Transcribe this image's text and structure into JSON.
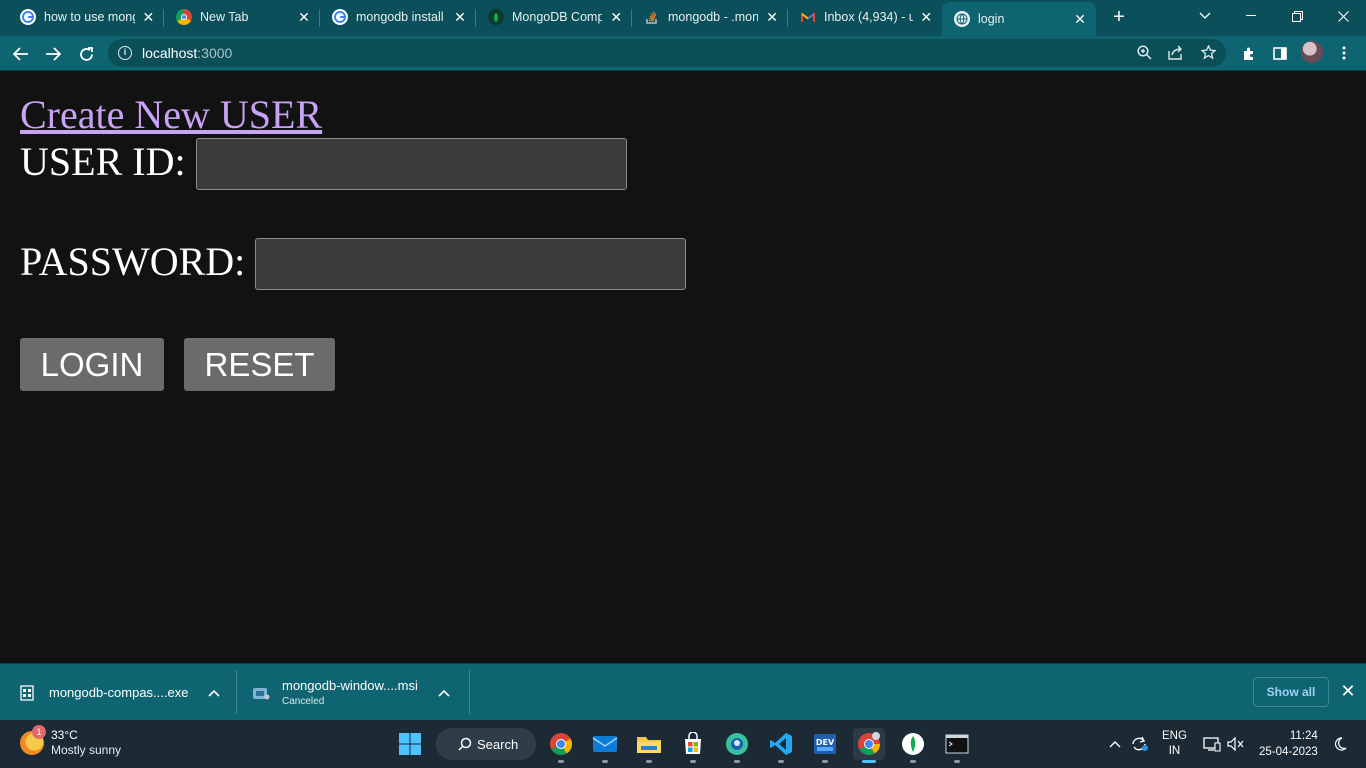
{
  "browser": {
    "tabs": [
      {
        "title": "how to use mong",
        "favicon": "google-icon",
        "active": false
      },
      {
        "title": "New Tab",
        "favicon": "chrome-icon",
        "active": false
      },
      {
        "title": "mongodb install",
        "favicon": "google-icon",
        "active": false
      },
      {
        "title": "MongoDB Comp",
        "favicon": "mongodb-leaf-icon",
        "active": false
      },
      {
        "title": "mongodb - .mon",
        "favicon": "stackoverflow-icon",
        "active": false
      },
      {
        "title": "Inbox (4,934) - u",
        "favicon": "gmail-icon",
        "active": false
      },
      {
        "title": "login",
        "favicon": "globe-icon",
        "active": true
      }
    ],
    "url_host": "localhost",
    "url_port": ":3000",
    "theme_color": "#0f6471"
  },
  "page": {
    "create_link": "Create New USER",
    "user_id_label": "USER ID:",
    "user_id_value": "",
    "password_label": "PASSWORD:",
    "password_value": "",
    "login_button": "LOGIN",
    "reset_button": "RESET",
    "link_color": "#c7a2f5"
  },
  "downloads": {
    "items": [
      {
        "name": "mongodb-compas....exe",
        "status": ""
      },
      {
        "name": "mongodb-window....msi",
        "status": "Canceled"
      }
    ],
    "show_all": "Show all"
  },
  "taskbar": {
    "weather_temp": "33°C",
    "weather_desc": "Mostly sunny",
    "weather_badge": "1",
    "search_label": "Search",
    "lang_top": "ENG",
    "lang_bottom": "IN",
    "time": "11:24",
    "date": "25-04-2023",
    "apps": [
      "windows-start-icon",
      "chrome-icon",
      "mail-icon",
      "file-explorer-icon",
      "ms-store-icon",
      "edge-icon",
      "vscode-icon",
      "dev-home-icon",
      "chrome-active-icon",
      "mongodb-compass-icon",
      "terminal-icon"
    ]
  }
}
